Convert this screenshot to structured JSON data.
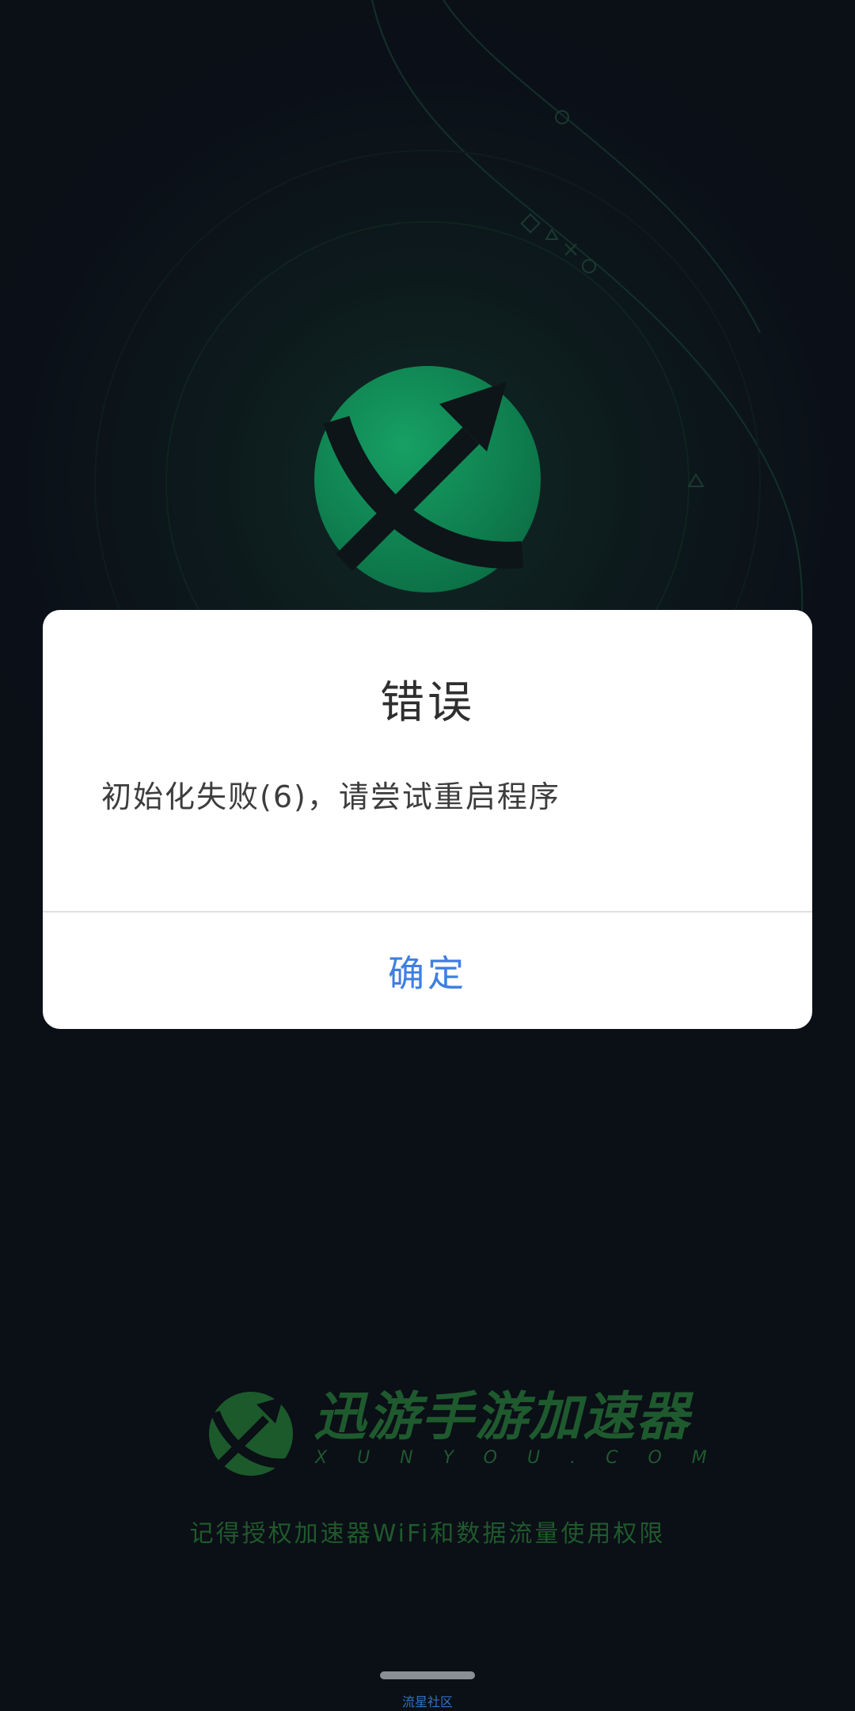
{
  "dialog": {
    "title": "错误",
    "message": "初始化失败(6)，请尝试重启程序",
    "confirm_label": "确定"
  },
  "brand": {
    "name": "迅游手游加速器",
    "domain": "XUNYOU.COM",
    "logo_icon": "xunyou-logo-icon",
    "globe_icon": "globe-arrow-icon"
  },
  "hint": "记得授权加速器WiFi和数据流量使用权限",
  "watermark": "流星社区",
  "colors": {
    "background": "#0b0f16",
    "accent_green": "#1fb86a",
    "brand_green": "#1e5a2e",
    "confirm_blue": "#3f7fe0"
  }
}
